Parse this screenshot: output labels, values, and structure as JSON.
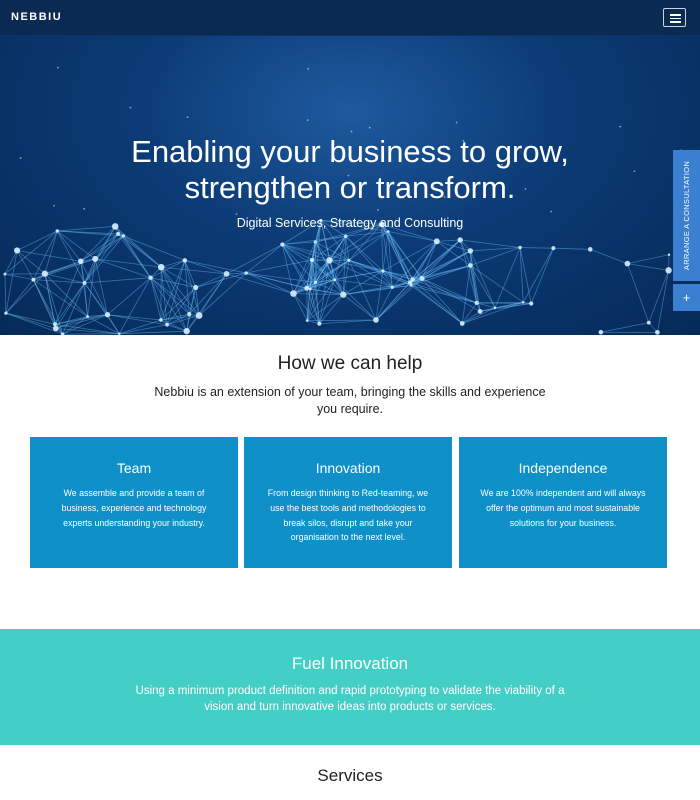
{
  "nav": {
    "logo": "NEBBIU",
    "menu_icon": "hamburger-icon"
  },
  "hero": {
    "title_line1": "Enabling your business to grow,",
    "title_line2": "strengthen or transform.",
    "subtitle": "Digital Services, Strategy and Consulting"
  },
  "side_tab": {
    "label": "ARRANGE A CONSULTATION",
    "plus": "+"
  },
  "help": {
    "title": "How we can help",
    "text": "Nebbiu is an extension of your team, bringing the skills and experience you require.",
    "cards": [
      {
        "title": "Team",
        "body": "We assemble and provide a team of business, experience and technology experts understanding your industry."
      },
      {
        "title": "Innovation",
        "body": "From design thinking to Red-teaming, we use the best tools and methodologies to break silos, disrupt and take your organisation to the next level."
      },
      {
        "title": "Independence",
        "body": "We are 100% independent and will always offer the optimum and most sustainable solutions for your business."
      }
    ]
  },
  "fuel": {
    "title": "Fuel Innovation",
    "text": "Using a minimum product definition and rapid prototyping to validate the viability of a vision and turn innovative ideas into products or services."
  },
  "services": {
    "title": "Services"
  },
  "colors": {
    "nav": "#0a2a52",
    "card": "#0f90c9",
    "fuel": "#44cfc6",
    "side_tab": "#3a7fd0"
  }
}
